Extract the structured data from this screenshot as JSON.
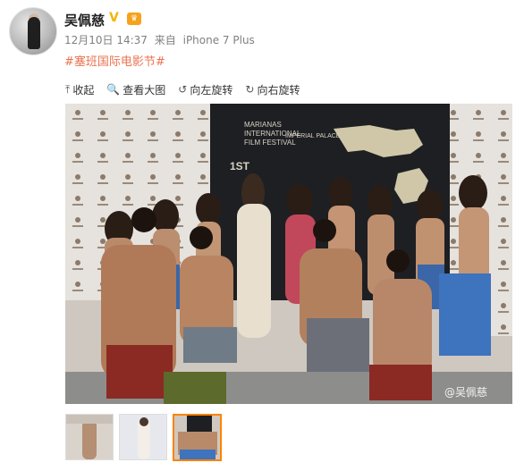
{
  "user": {
    "name": "吴佩慈",
    "verified_glyph": "V",
    "vip_glyph": "♛"
  },
  "post": {
    "date": "12月10日 14:37",
    "source_prefix": "来自",
    "source": "iPhone 7 Plus",
    "hashtag": "#塞班国际电影节#"
  },
  "toolbar": {
    "items": [
      {
        "icon": "collapse-icon",
        "glyph": "⤒",
        "label": "收起"
      },
      {
        "icon": "zoom-icon",
        "glyph": "🔍",
        "label": "查看大图"
      },
      {
        "icon": "rotate-left-icon",
        "glyph": "↺",
        "label": "向左旋转"
      },
      {
        "icon": "rotate-right-icon",
        "glyph": "↻",
        "label": "向右旋转"
      }
    ]
  },
  "photo": {
    "banner_line1": "MARIANAS",
    "banner_line2": "INTERNATIONAL",
    "banner_line3": "FILM FESTIVAL",
    "banner_hotel": "IMPERIAL PALACE",
    "banner_edition": "1ST",
    "watermark": "@吴佩慈"
  },
  "thumbnails": {
    "count": 3,
    "selected_index": 2
  },
  "colors": {
    "accent": "#eb7350",
    "verified": "#f6b300",
    "selected_border": "#ff8200"
  }
}
